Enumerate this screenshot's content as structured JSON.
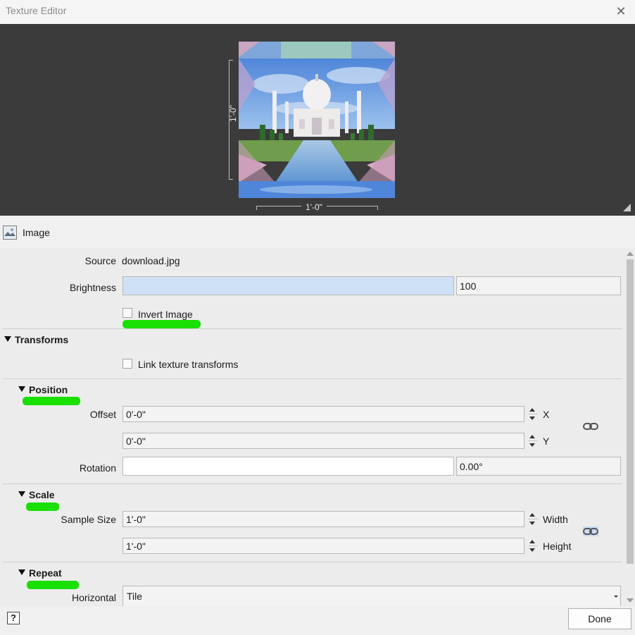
{
  "window": {
    "title": "Texture Editor"
  },
  "preview": {
    "height_label": "1'-0\"",
    "width_label": "1'-0\""
  },
  "image_section": {
    "label": "Image"
  },
  "image": {
    "source_label": "Source",
    "source_value": "download.jpg",
    "brightness_label": "Brightness",
    "brightness_value": "100",
    "invert_label": "Invert Image",
    "invert_checked": false
  },
  "transforms": {
    "label": "Transforms",
    "link_label": "Link texture transforms",
    "link_checked": false
  },
  "position": {
    "label": "Position",
    "offset_label": "Offset",
    "offset_x": "0'-0\"",
    "offset_y": "0'-0\"",
    "x_label": "X",
    "y_label": "Y",
    "rotation_label": "Rotation",
    "rotation_value": "0.00°"
  },
  "scale": {
    "label": "Scale",
    "sample_size_label": "Sample Size",
    "width_value": "1'-0\"",
    "height_value": "1'-0\"",
    "width_label": "Width",
    "height_label": "Height"
  },
  "repeat": {
    "label": "Repeat",
    "horizontal_label": "Horizontal",
    "horizontal_value": "Tile"
  },
  "footer": {
    "help_label": "?",
    "done_label": "Done"
  },
  "colors": {
    "highlight": "#19e000",
    "slider_fill": "#cfe1f7",
    "preview_bg": "#3b3b3b"
  }
}
